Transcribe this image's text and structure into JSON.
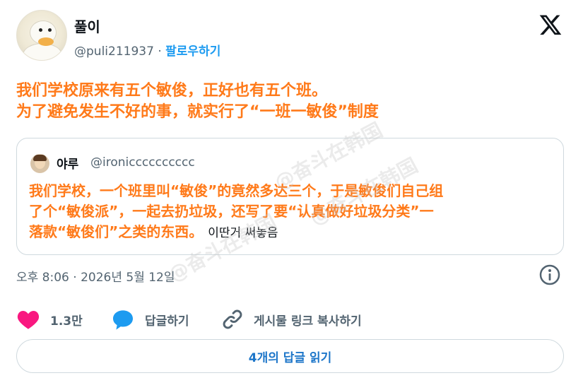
{
  "author": {
    "display_name": "풀이",
    "handle": "@puli211937",
    "separator": "·",
    "follow_label": "팔로우하기"
  },
  "post": {
    "line1_zh": "我们学校原来有五个敏俊，正好也有五个班。",
    "line2_zh": "为了避免发生不好的事，就实行了“一班一敏俊”制度"
  },
  "quoted_post": {
    "display_name": "야루",
    "handle": "@ironicccccccccc",
    "line1_zh": "我们学校，一个班里叫“敏俊”的竟然多达三个，于是敏俊们自己组",
    "line2_zh": "了个“敏俊派”，一起去扔垃圾，还写了要“认真做好垃圾分类”一",
    "line3_zh": "落款“敏俊们”之类的东西。",
    "line3_ko": "이딴거 써놓음"
  },
  "timestamp": "오후 8:06 · 2026년 5월 12일",
  "actions": {
    "like_count": "1.3만",
    "reply_label": "답글하기",
    "copy_link_label": "게시물 링크 복사하기"
  },
  "read_replies_label": "4개의 답글 읽기",
  "watermark": "@奋斗在韩国",
  "colors": {
    "accent": "#1d9bf0",
    "overlay_text": "#ff7a1a",
    "like": "#f91880",
    "reply": "#1d9bf0",
    "muted": "#536471"
  }
}
